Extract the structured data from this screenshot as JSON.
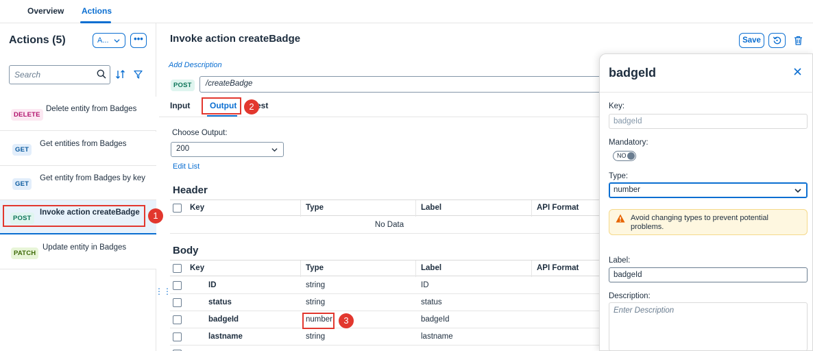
{
  "top_tabs": [
    {
      "label": "Overview"
    },
    {
      "label": "Actions"
    }
  ],
  "sidebar": {
    "title": "Actions (5)",
    "selector_label": "A...",
    "more_label": "•••",
    "search_placeholder": "Search",
    "items": [
      {
        "method": "DELETE",
        "label": "Delete entity from Badges"
      },
      {
        "method": "GET",
        "label": "Get entities from Badges"
      },
      {
        "method": "GET",
        "label": "Get entity from Badges by key"
      },
      {
        "method": "POST",
        "label": "Invoke action createBadge",
        "selected": true
      },
      {
        "method": "PATCH",
        "label": "Update entity in Badges"
      }
    ]
  },
  "main": {
    "title": "Invoke action createBadge",
    "save_label": "Save",
    "add_description": "Add Description",
    "method": "POST",
    "path": "/createBadge",
    "subtabs": [
      {
        "label": "Input"
      },
      {
        "label": "Output",
        "active": true
      },
      {
        "label": "est"
      }
    ],
    "choose_output_label": "Choose Output:",
    "output_value": "200",
    "edit_list": "Edit List",
    "header_section": "Header",
    "body_section": "Body",
    "columns": [
      "Key",
      "Type",
      "Label",
      "API Format"
    ],
    "no_data": "No Data",
    "body_rows": [
      {
        "key": "ID",
        "type": "string",
        "label": "ID"
      },
      {
        "key": "status",
        "type": "string",
        "label": "status"
      },
      {
        "key": "badgeId",
        "type": "number",
        "label": "badgeId"
      },
      {
        "key": "lastname",
        "type": "string",
        "label": "lastname"
      }
    ]
  },
  "annotations": [
    "1",
    "2",
    "3"
  ],
  "panel": {
    "title": "badgeId",
    "key_label": "Key:",
    "key_value": "badgeId",
    "mandatory_label": "Mandatory:",
    "mandatory_value": "NO",
    "type_label": "Type:",
    "type_value": "number",
    "warning": "Avoid changing types to prevent potential problems.",
    "label_label": "Label:",
    "label_value": "badgeId",
    "description_label": "Description:",
    "description_placeholder": "Enter Description"
  },
  "colors": {
    "accent": "#0a6ed1",
    "annotation": "#e2372e",
    "warning_bg": "#fef7e0"
  }
}
